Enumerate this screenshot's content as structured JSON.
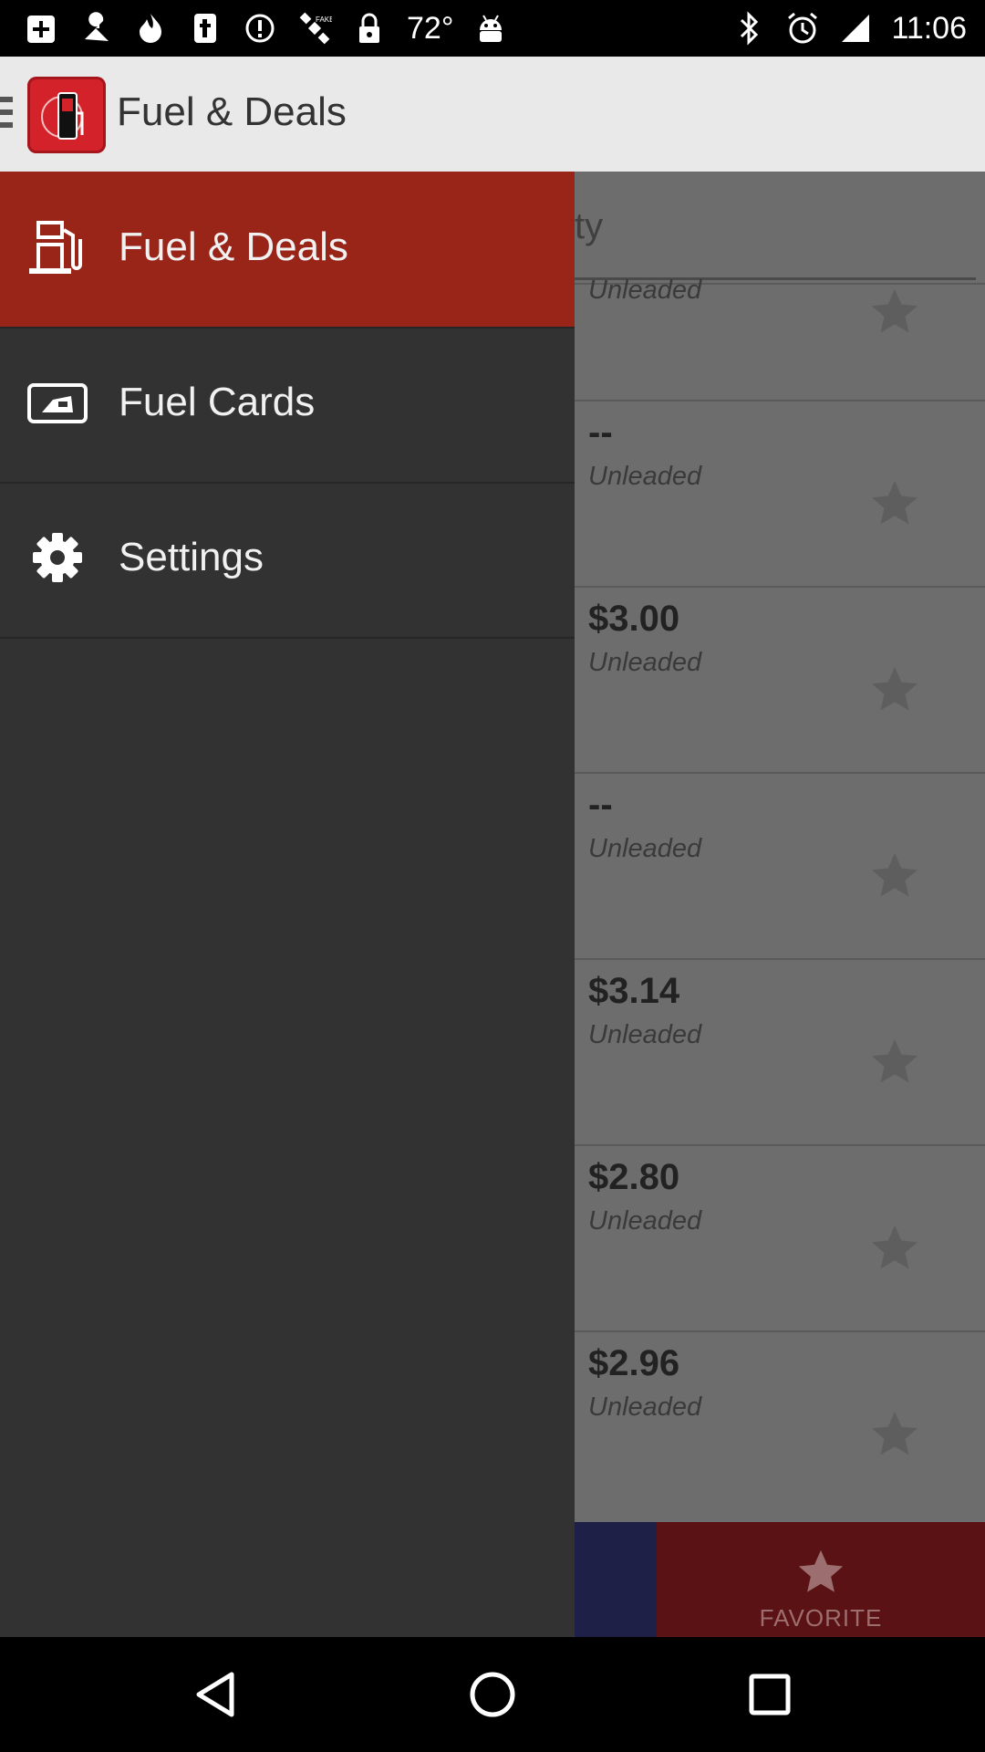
{
  "status_bar": {
    "temperature": "72°",
    "time": "11:06",
    "left_icons": [
      "add-box-icon",
      "wrench-icon",
      "flame-icon",
      "tumblr-icon",
      "alert-circle-icon",
      "satellite-icon",
      "lock-icon",
      "android-icon"
    ],
    "right_icons": [
      "bluetooth-icon",
      "alarm-icon",
      "signal-icon"
    ]
  },
  "app_bar": {
    "title": "Fuel & Deals"
  },
  "drawer": {
    "items": [
      {
        "label": "Fuel & Deals",
        "icon": "fuel-pump-icon",
        "active": true
      },
      {
        "label": "Fuel Cards",
        "icon": "fuel-card-icon",
        "active": false
      },
      {
        "label": "Settings",
        "icon": "gear-icon",
        "active": false
      }
    ]
  },
  "background_list": {
    "search_fragment": "ty",
    "rows": [
      {
        "price": "",
        "fuel": "Unleaded"
      },
      {
        "price": "--",
        "fuel": "Unleaded"
      },
      {
        "price": "$3.00",
        "fuel": "Unleaded"
      },
      {
        "price": "--",
        "fuel": "Unleaded"
      },
      {
        "price": "$3.14",
        "fuel": "Unleaded"
      },
      {
        "price": "$2.80",
        "fuel": "Unleaded"
      },
      {
        "price": "$2.96",
        "fuel": "Unleaded"
      }
    ],
    "favorite_label": "FAVORITE"
  },
  "colors": {
    "active_item": "#992518",
    "drawer_bg": "#323232",
    "app_logo": "#d4222b"
  }
}
